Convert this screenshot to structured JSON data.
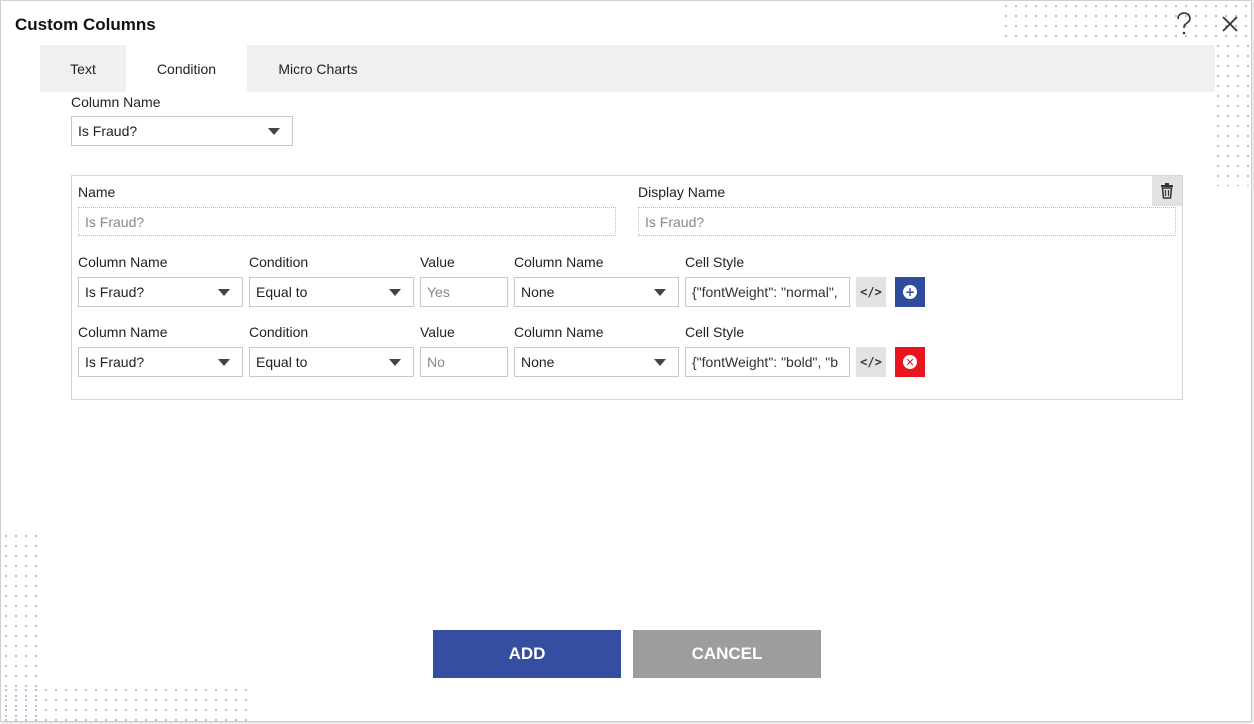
{
  "dialog": {
    "title": "Custom Columns",
    "help_icon": "question-icon",
    "close_icon": "close-icon"
  },
  "tabs": [
    {
      "label": "Text",
      "active": false
    },
    {
      "label": "Condition",
      "active": true
    },
    {
      "label": "Micro Charts",
      "active": false
    }
  ],
  "column_name": {
    "label": "Column Name",
    "selected": "Is Fraud?"
  },
  "panel": {
    "name_label": "Name",
    "name_placeholder": "Is Fraud?",
    "display_name_label": "Display Name",
    "display_name_placeholder": "Is Fraud?",
    "delete_icon": "trash-icon",
    "headers": {
      "column_name": "Column Name",
      "condition": "Condition",
      "value": "Value",
      "target_column": "Column Name",
      "cell_style": "Cell Style"
    },
    "rows": [
      {
        "column_name": "Is Fraud?",
        "condition": "Equal to",
        "value_placeholder": "Yes",
        "target_column": "None",
        "cell_style": "{\"fontWeight\": \"normal\", ",
        "code_icon": "code-icon",
        "action_icon": "plus-circle-icon",
        "action_color": "#2e4d9b"
      },
      {
        "column_name": "Is Fraud?",
        "condition": "Equal to",
        "value_placeholder": "No",
        "target_column": "None",
        "cell_style": "{\"fontWeight\": \"bold\", \"b",
        "code_icon": "code-icon",
        "action_icon": "x-circle-icon",
        "action_color": "#e8141e"
      }
    ]
  },
  "buttons": {
    "add": "ADD",
    "cancel": "CANCEL"
  },
  "colors": {
    "primary": "#354ea1",
    "secondary": "#9d9d9d",
    "danger": "#e8141e"
  }
}
